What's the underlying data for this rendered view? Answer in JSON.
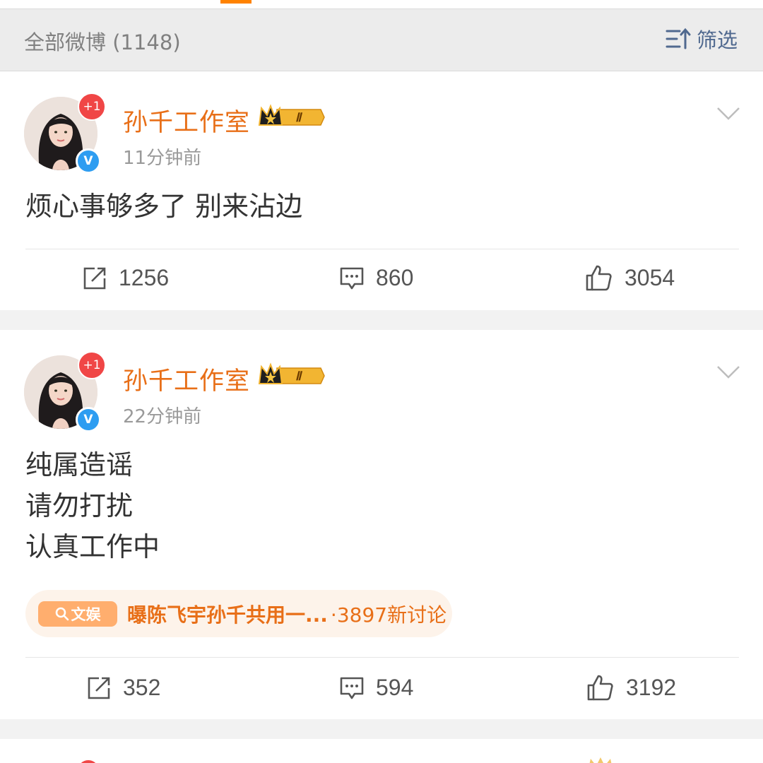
{
  "filter_bar": {
    "count_label": "全部微博 (1148)",
    "filter_label": "筛选",
    "filter_icon": "filter-sort-icon"
  },
  "colors": {
    "accent_orange": "#ff8200",
    "username": "#e86f18",
    "link_blue": "#50698f",
    "verified_blue": "#2e9df1",
    "badge_red": "#f04646"
  },
  "posts": [
    {
      "username": "孙千工作室",
      "time": "11分钟前",
      "avatar_badge": "+1",
      "vip_level": "Ⅱ",
      "lines": [
        "烦心事够多了 别来沾边"
      ],
      "reposts": "1256",
      "comments": "860",
      "likes": "3054"
    },
    {
      "username": "孙千工作室",
      "time": "22分钟前",
      "avatar_badge": "+1",
      "vip_level": "Ⅱ",
      "lines": [
        "纯属造谣",
        "请勿打扰",
        "认真工作中"
      ],
      "topic": {
        "tag": "文娱",
        "title": "曝陈飞宇孙千共用一...",
        "count": "·3897新讨论"
      },
      "reposts": "352",
      "comments": "594",
      "likes": "3192"
    }
  ]
}
